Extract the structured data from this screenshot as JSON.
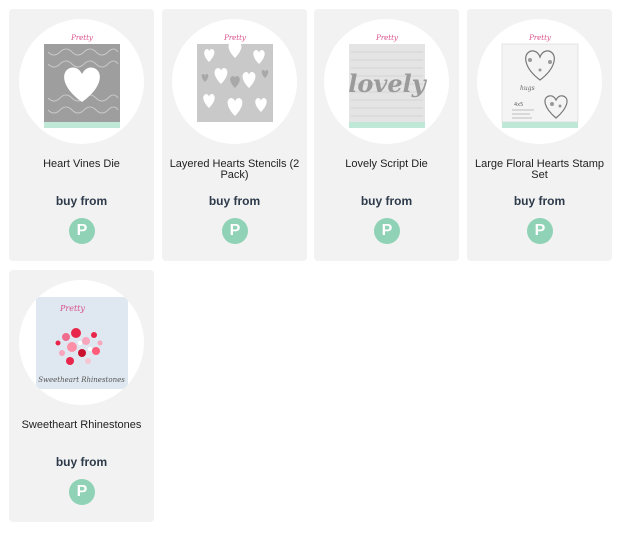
{
  "products": [
    {
      "title": "Heart Vines Die",
      "buy_label": "buy from",
      "store_letter": "P",
      "image_icon": "heart-vines-die-package"
    },
    {
      "title": "Layered Hearts Stencils (2 Pack)",
      "buy_label": "buy from",
      "store_letter": "P",
      "image_icon": "layered-hearts-stencil-package"
    },
    {
      "title": "Lovely Script Die",
      "buy_label": "buy from",
      "store_letter": "P",
      "image_icon": "lovely-script-die-package"
    },
    {
      "title": "Large Floral Hearts Stamp Set",
      "buy_label": "buy from",
      "store_letter": "P",
      "image_icon": "floral-hearts-stamp-package"
    },
    {
      "title": "Sweetheart Rhinestones",
      "buy_label": "buy from",
      "store_letter": "P",
      "image_icon": "sweetheart-rhinestones-package",
      "package_caption": "Sweetheart Rhinestones"
    }
  ],
  "colors": {
    "card_bg": "#f2f2f2",
    "badge": "#8fd2b5",
    "buy_text": "#2d3a4a",
    "package_mint": "#bfe9d6"
  }
}
